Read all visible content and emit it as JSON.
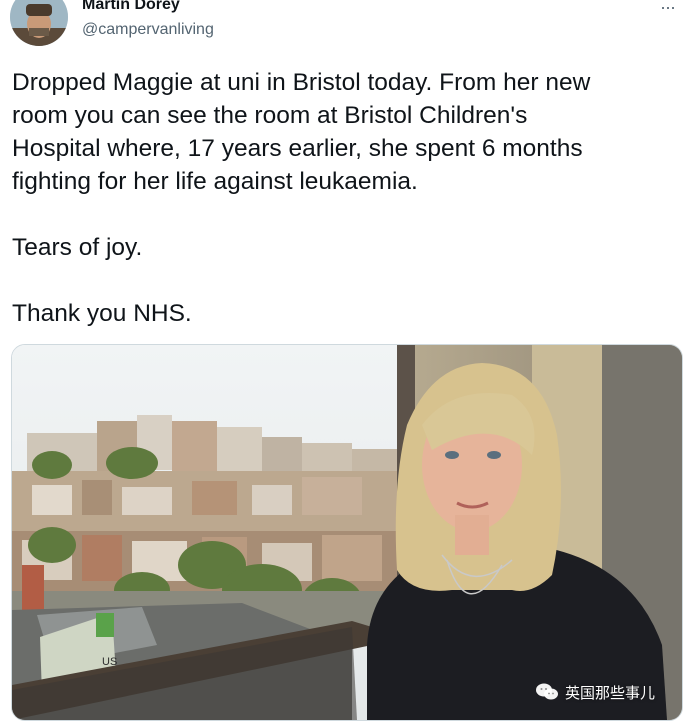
{
  "tweet": {
    "author_name": "Martin Dorey",
    "author_handle": "@campervanliving",
    "more_icon": "...",
    "lines": [
      "Dropped Maggie at uni in Bristol today. From her new",
      "room you can see the room at   Bristol Children's",
      "Hospital where, 17 years earlier, she spent 6 months",
      "fighting for her life against leukaemia."
    ],
    "line2": "Tears of joy.",
    "line3": "Thank you NHS."
  },
  "photo": {
    "sign_text": "US"
  },
  "watermark": {
    "text": "英国那些事儿",
    "icon": "wechat-icon"
  },
  "colors": {
    "handle": "#536471",
    "text": "#0f1419",
    "border": "#cfd9de"
  }
}
